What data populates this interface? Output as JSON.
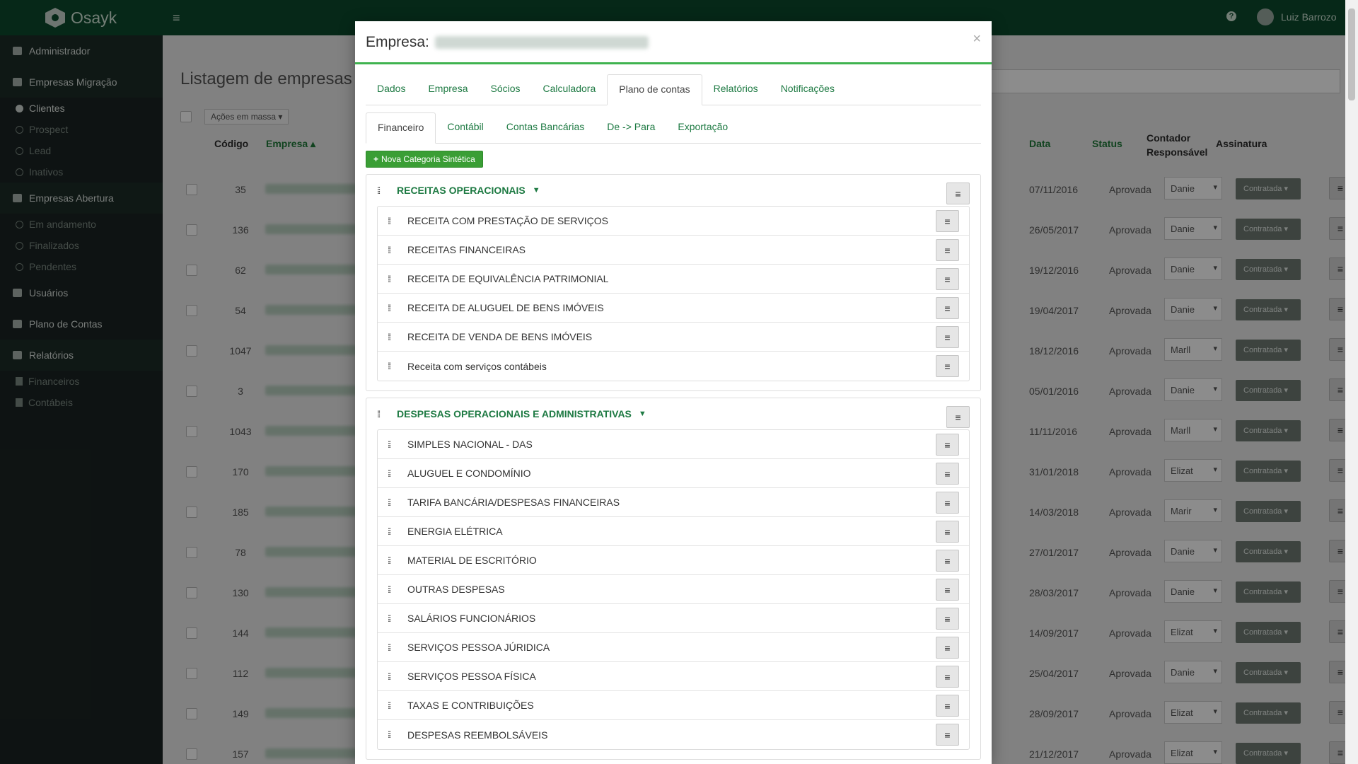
{
  "app": {
    "name": "Osayk",
    "user": "Luiz Barrozo"
  },
  "sidebar": {
    "sections": [
      {
        "label": "Administrador",
        "items": []
      },
      {
        "label": "Empresas Migração",
        "items": [
          {
            "label": "Clientes",
            "active": true
          },
          {
            "label": "Prospect"
          },
          {
            "label": "Lead"
          },
          {
            "label": "Inativos"
          }
        ]
      },
      {
        "label": "Empresas Abertura",
        "items": [
          {
            "label": "Em andamento"
          },
          {
            "label": "Finalizados"
          },
          {
            "label": "Pendentes"
          }
        ]
      },
      {
        "label": "Usuários",
        "items": []
      },
      {
        "label": "Plano de Contas",
        "items": []
      },
      {
        "label": "Relatórios",
        "items": [
          {
            "label": "Financeiros"
          },
          {
            "label": "Contábeis"
          }
        ]
      }
    ]
  },
  "page": {
    "title": "Listagem de empresas",
    "bulk_actions": "Ações em massa",
    "columns": {
      "code": "Código",
      "company": "Empresa",
      "date": "Data",
      "status": "Status",
      "accountant_1": "Contador",
      "accountant_2": "Responsável",
      "signature": "Assinatura"
    },
    "rows": [
      {
        "code": "35",
        "date": "07/11/2016",
        "status": "Aprovada",
        "accountant": "Danie",
        "signature": "Contratada"
      },
      {
        "code": "136",
        "date": "26/05/2017",
        "status": "Aprovada",
        "accountant": "Danie",
        "signature": "Contratada"
      },
      {
        "code": "62",
        "date": "19/12/2016",
        "status": "Aprovada",
        "accountant": "Danie",
        "signature": "Contratada"
      },
      {
        "code": "54",
        "date": "19/04/2017",
        "status": "Aprovada",
        "accountant": "Danie",
        "signature": "Contratada"
      },
      {
        "code": "1047",
        "date": "18/12/2016",
        "status": "Aprovada",
        "accountant": "Marll",
        "signature": "Contratada"
      },
      {
        "code": "3",
        "date": "05/01/2016",
        "status": "Aprovada",
        "accountant": "Danie",
        "signature": "Contratada"
      },
      {
        "code": "1043",
        "date": "11/11/2016",
        "status": "Aprovada",
        "accountant": "Marll",
        "signature": "Contratada"
      },
      {
        "code": "170",
        "date": "31/01/2018",
        "status": "Aprovada",
        "accountant": "Elizat",
        "signature": "Contratada"
      },
      {
        "code": "185",
        "date": "14/03/2018",
        "status": "Aprovada",
        "accountant": "Marir",
        "signature": "Contratada"
      },
      {
        "code": "78",
        "date": "27/01/2017",
        "status": "Aprovada",
        "accountant": "Danie",
        "signature": "Contratada"
      },
      {
        "code": "130",
        "date": "28/03/2017",
        "status": "Aprovada",
        "accountant": "Danie",
        "signature": "Contratada"
      },
      {
        "code": "144",
        "date": "14/09/2017",
        "status": "Aprovada",
        "accountant": "Elizat",
        "signature": "Contratada"
      },
      {
        "code": "112",
        "date": "25/04/2017",
        "status": "Aprovada",
        "accountant": "Danie",
        "signature": "Contratada"
      },
      {
        "code": "149",
        "date": "28/09/2017",
        "status": "Aprovada",
        "accountant": "Elizat",
        "signature": "Contratada"
      },
      {
        "code": "157",
        "date": "21/12/2017",
        "status": "Aprovada",
        "accountant": "Elizat",
        "signature": "Contratada"
      }
    ]
  },
  "modal": {
    "title_prefix": "Empresa:",
    "close": "×",
    "tabs": [
      "Dados",
      "Empresa",
      "Sócios",
      "Calculadora",
      "Plano de contas",
      "Relatórios",
      "Notificações"
    ],
    "active_tab": "Plano de contas",
    "subtabs": [
      "Financeiro",
      "Contábil",
      "Contas Bancárias",
      "De -> Para",
      "Exportação"
    ],
    "active_subtab": "Financeiro",
    "new_button": "Nova Categoria Sintética",
    "categories": [
      {
        "title": "RECEITAS OPERACIONAIS",
        "items": [
          "RECEITA COM PRESTAÇÃO DE SERVIÇOS",
          "RECEITAS FINANCEIRAS",
          "RECEITA DE EQUIVALÊNCIA PATRIMONIAL",
          "RECEITA DE ALUGUEL DE BENS IMÓVEIS",
          "RECEITA DE VENDA DE BENS IMÓVEIS",
          "Receita com serviços contábeis"
        ]
      },
      {
        "title": "DESPESAS OPERACIONAIS E ADMINISTRATIVAS",
        "items": [
          "SIMPLES NACIONAL - DAS",
          "ALUGUEL E CONDOMÍNIO",
          "TARIFA BANCÁRIA/DESPESAS FINANCEIRAS",
          "ENERGIA ELÉTRICA",
          "MATERIAL DE ESCRITÓRIO",
          "OUTRAS DESPESAS",
          "SALÁRIOS FUNCIONÁRIOS",
          "SERVIÇOS PESSOA JÚRIDICA",
          "SERVIÇOS PESSOA FÍSICA",
          "TAXAS E CONTRIBUIÇÕES",
          "DESPESAS REEMBOLSÁVEIS"
        ]
      }
    ]
  },
  "colors": {
    "topbar": "#0b4a2d",
    "sidebar": "#1b2423",
    "accent": "#3fb34f",
    "link": "#1e7a43",
    "button": "#3a9e35"
  }
}
